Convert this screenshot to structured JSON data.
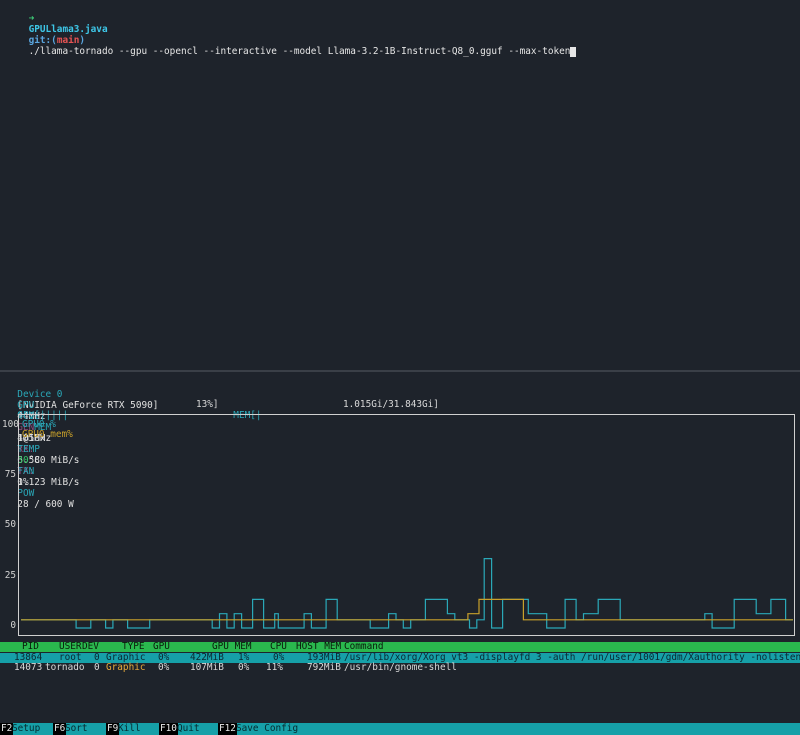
{
  "terminal": {
    "prompt_arrow": "➜",
    "dir": "GPULlama3.java",
    "git_label": "git:(",
    "branch": "main",
    "git_close": ")",
    "command": "./llama-tornado --gpu --opencl --interactive --model Llama-3.2-1B-Instruct-Q8_0.gguf --max-token"
  },
  "nvtop": {
    "device_label": "Device 0",
    "device_name": "[NVIDIA GeForce RTX 5090]",
    "pcie_label": "PCIe",
    "gen_label": "GEN",
    "gen_value": "1@16x",
    "rx_label": "RX:",
    "rx_value": "6.580 MiB/s",
    "tx_label": "TX:",
    "tx_value": "1.123 MiB/s",
    "gpu_clk_label": "GPU",
    "gpu_clk_value": "44MHz",
    "mem_clk_label": "MEM",
    "mem_clk_value": "405MHz",
    "temp_label": "TEMP",
    "temp_value": "30",
    "temp_unit": "°C",
    "fan_label": "FAN",
    "fan_value": "0%",
    "pow_label": "POW",
    "pow_value": "28 / 600 W",
    "gpu_util_label": "GPU[",
    "gpu_util_bar": "|||||",
    "gpu_util_value": "13%]",
    "mem_util_label": "MEM[",
    "mem_util_bar": "|",
    "mem_util_value": "1.015Gi/31.843Gi]",
    "gpu_util_fraction": 0.13,
    "mem_util_fraction": 0.032
  },
  "chart_data": {
    "type": "line",
    "y_ticks": [
      "100",
      "75",
      "50",
      "25",
      "0"
    ],
    "ylim": [
      0,
      100
    ],
    "legend": [
      "GPU0 %",
      "GPU0 mem%"
    ],
    "colors": {
      "gpu": "#2aa8b8",
      "mem": "#c8a02a"
    },
    "series": [
      {
        "name": "GPU0 %",
        "values": [
          4,
          4,
          4,
          4,
          4,
          4,
          4,
          4,
          4,
          4,
          4,
          4,
          4,
          4,
          4,
          0,
          0,
          0,
          0,
          4,
          4,
          4,
          4,
          0,
          0,
          4,
          4,
          4,
          4,
          0,
          0,
          0,
          0,
          0,
          0,
          4,
          4,
          4,
          4,
          4,
          4,
          4,
          4,
          4,
          4,
          4,
          4,
          4,
          4,
          4,
          4,
          4,
          0,
          0,
          7,
          7,
          0,
          0,
          7,
          7,
          0,
          0,
          0,
          14,
          14,
          14,
          0,
          0,
          0,
          7,
          0,
          0,
          0,
          0,
          0,
          0,
          0,
          7,
          7,
          0,
          0,
          0,
          0,
          14,
          14,
          14,
          4,
          4,
          4,
          4,
          4,
          4,
          4,
          4,
          4,
          0,
          0,
          0,
          0,
          0,
          7,
          7,
          4,
          4,
          0,
          0,
          4,
          4,
          4,
          4,
          14,
          14,
          14,
          14,
          14,
          14,
          7,
          7,
          4,
          4,
          4,
          4,
          0,
          0,
          4,
          4,
          34,
          34,
          0,
          0,
          0,
          14,
          14,
          14,
          14,
          14,
          14,
          14,
          7,
          7,
          7,
          7,
          7,
          0,
          0,
          0,
          0,
          0,
          14,
          14,
          14,
          4,
          4,
          7,
          7,
          7,
          7,
          14,
          14,
          14,
          14,
          14,
          14,
          4,
          4,
          4,
          4,
          4,
          4,
          4,
          4,
          4,
          4,
          4,
          4,
          4,
          4,
          4,
          4,
          4,
          4,
          4,
          4,
          4,
          4,
          4,
          7,
          7,
          0,
          0,
          0,
          0,
          0,
          0,
          14,
          14,
          14,
          14,
          14,
          14,
          7,
          7,
          7,
          7,
          14,
          14,
          14,
          14,
          4,
          4
        ]
      },
      {
        "name": "GPU0 mem%",
        "values": [
          4,
          4,
          4,
          4,
          4,
          4,
          4,
          4,
          4,
          4,
          4,
          4,
          4,
          4,
          4,
          4,
          4,
          4,
          4,
          4,
          4,
          4,
          4,
          4,
          4,
          4,
          4,
          4,
          4,
          4,
          4,
          4,
          4,
          4,
          4,
          4,
          4,
          4,
          4,
          4,
          4,
          4,
          4,
          4,
          4,
          4,
          4,
          4,
          4,
          4,
          4,
          4,
          4,
          4,
          4,
          4,
          4,
          4,
          4,
          4,
          4,
          4,
          4,
          4,
          4,
          4,
          4,
          4,
          4,
          4,
          4,
          4,
          4,
          4,
          4,
          4,
          4,
          4,
          4,
          4,
          4,
          4,
          4,
          4,
          4,
          4,
          4,
          4,
          4,
          4,
          4,
          4,
          4,
          4,
          4,
          4,
          4,
          4,
          4,
          4,
          4,
          4,
          4,
          4,
          4,
          4,
          4,
          4,
          4,
          4,
          4,
          4,
          4,
          4,
          4,
          4,
          4,
          4,
          4,
          4,
          4,
          7,
          7,
          7,
          14,
          14,
          14,
          14,
          14,
          14,
          14,
          14,
          14,
          14,
          14,
          14,
          4,
          4,
          4,
          4,
          4,
          4,
          4,
          4,
          4,
          4,
          4,
          4,
          4,
          4,
          4,
          4,
          4,
          4,
          4,
          4,
          4,
          4,
          4,
          4,
          4,
          4,
          4,
          4,
          4,
          4,
          4,
          4,
          4,
          4,
          4,
          4,
          4,
          4,
          4,
          4,
          4,
          4,
          4,
          4,
          4,
          4,
          4,
          4,
          4,
          4,
          4,
          4,
          4,
          4,
          4,
          4,
          4,
          4,
          4,
          4,
          4,
          4,
          4,
          4,
          4,
          4,
          4,
          4,
          4,
          4,
          4,
          4,
          4
        ]
      }
    ]
  },
  "process_table": {
    "headers": [
      "PID",
      "USER",
      "DEV",
      "TYPE",
      "GPU",
      "GPU MEM",
      "CPU",
      "HOST MEM",
      "Command"
    ],
    "rows": [
      [
        "13864",
        "root",
        "0",
        "Graphic",
        "0%",
        "422MiB",
        "1%",
        "0%",
        "193MiB",
        "/usr/lib/xorg/Xorg vt3 -displayfd 3 -auth /run/user/1001/gdm/Xauthority -nolisten tcp"
      ],
      [
        "14073",
        "tornado",
        "0",
        "Graphic",
        "0%",
        "107MiB",
        "0%",
        "11%",
        "792MiB",
        "/usr/bin/gnome-shell"
      ]
    ]
  },
  "footer": [
    {
      "key": "F2",
      "label": "Setup"
    },
    {
      "key": "F6",
      "label": "Sort"
    },
    {
      "key": "F9",
      "label": "Kill"
    },
    {
      "key": "F10",
      "label": "Quit"
    },
    {
      "key": "F12",
      "label": "Save Config"
    }
  ]
}
